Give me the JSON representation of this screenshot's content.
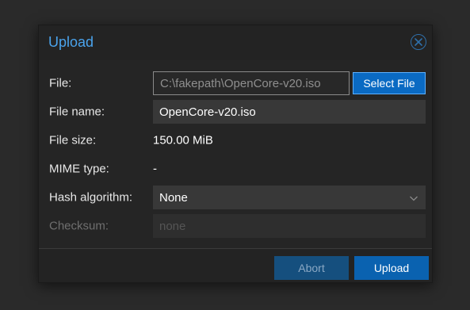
{
  "dialog": {
    "title": "Upload",
    "close_icon": "close-circle-icon"
  },
  "form": {
    "file": {
      "label": "File:",
      "path_value": "C:\\fakepath\\OpenCore-v20.iso",
      "select_button_label": "Select File"
    },
    "file_name": {
      "label": "File name:",
      "value": "OpenCore-v20.iso"
    },
    "file_size": {
      "label": "File size:",
      "value": "150.00 MiB"
    },
    "mime_type": {
      "label": "MIME type:",
      "value": "-"
    },
    "hash_algorithm": {
      "label": "Hash algorithm:",
      "selected": "None",
      "chevron_icon": "chevron-down-icon"
    },
    "checksum": {
      "label": "Checksum:",
      "placeholder": "none",
      "disabled": true
    }
  },
  "footer": {
    "abort_label": "Abort",
    "upload_label": "Upload"
  },
  "colors": {
    "accent": "#4aa3ec",
    "primary_button": "#0a62b0",
    "disabled_button": "#154f7e",
    "background": "#2a2a2a"
  }
}
